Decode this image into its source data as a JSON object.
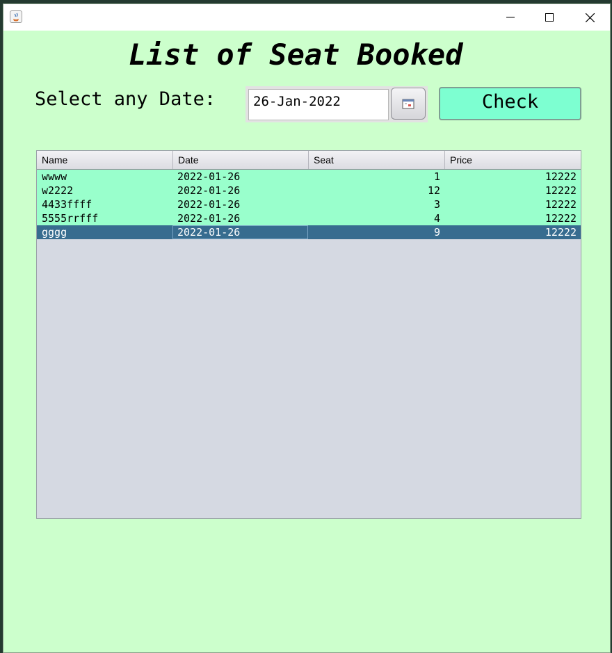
{
  "window": {
    "title": ""
  },
  "page": {
    "heading": "List of Seat Booked"
  },
  "date_picker": {
    "label": "Select any Date:",
    "value": "26-Jan-2022",
    "calendar_icon": "calendar-icon"
  },
  "check_button": {
    "label": "Check",
    "color": "#7dffd1"
  },
  "table": {
    "columns": [
      "Name",
      "Date",
      "Seat",
      "Price"
    ],
    "rows": [
      {
        "name": "wwww",
        "date": "2022-01-26",
        "seat": "1",
        "price": "12222"
      },
      {
        "name": "w2222",
        "date": "2022-01-26",
        "seat": "12",
        "price": "12222"
      },
      {
        "name": "4433ffff",
        "date": "2022-01-26",
        "seat": "3",
        "price": "12222"
      },
      {
        "name": "5555rrfff",
        "date": "2022-01-26",
        "seat": "4",
        "price": "12222"
      },
      {
        "name": "gggg",
        "date": "2022-01-26",
        "seat": "9",
        "price": "12222"
      }
    ],
    "selected_row": 4,
    "row_color": "#99ffcc",
    "selected_color": "#376c8f"
  },
  "colors": {
    "background": "#ccffcc"
  }
}
